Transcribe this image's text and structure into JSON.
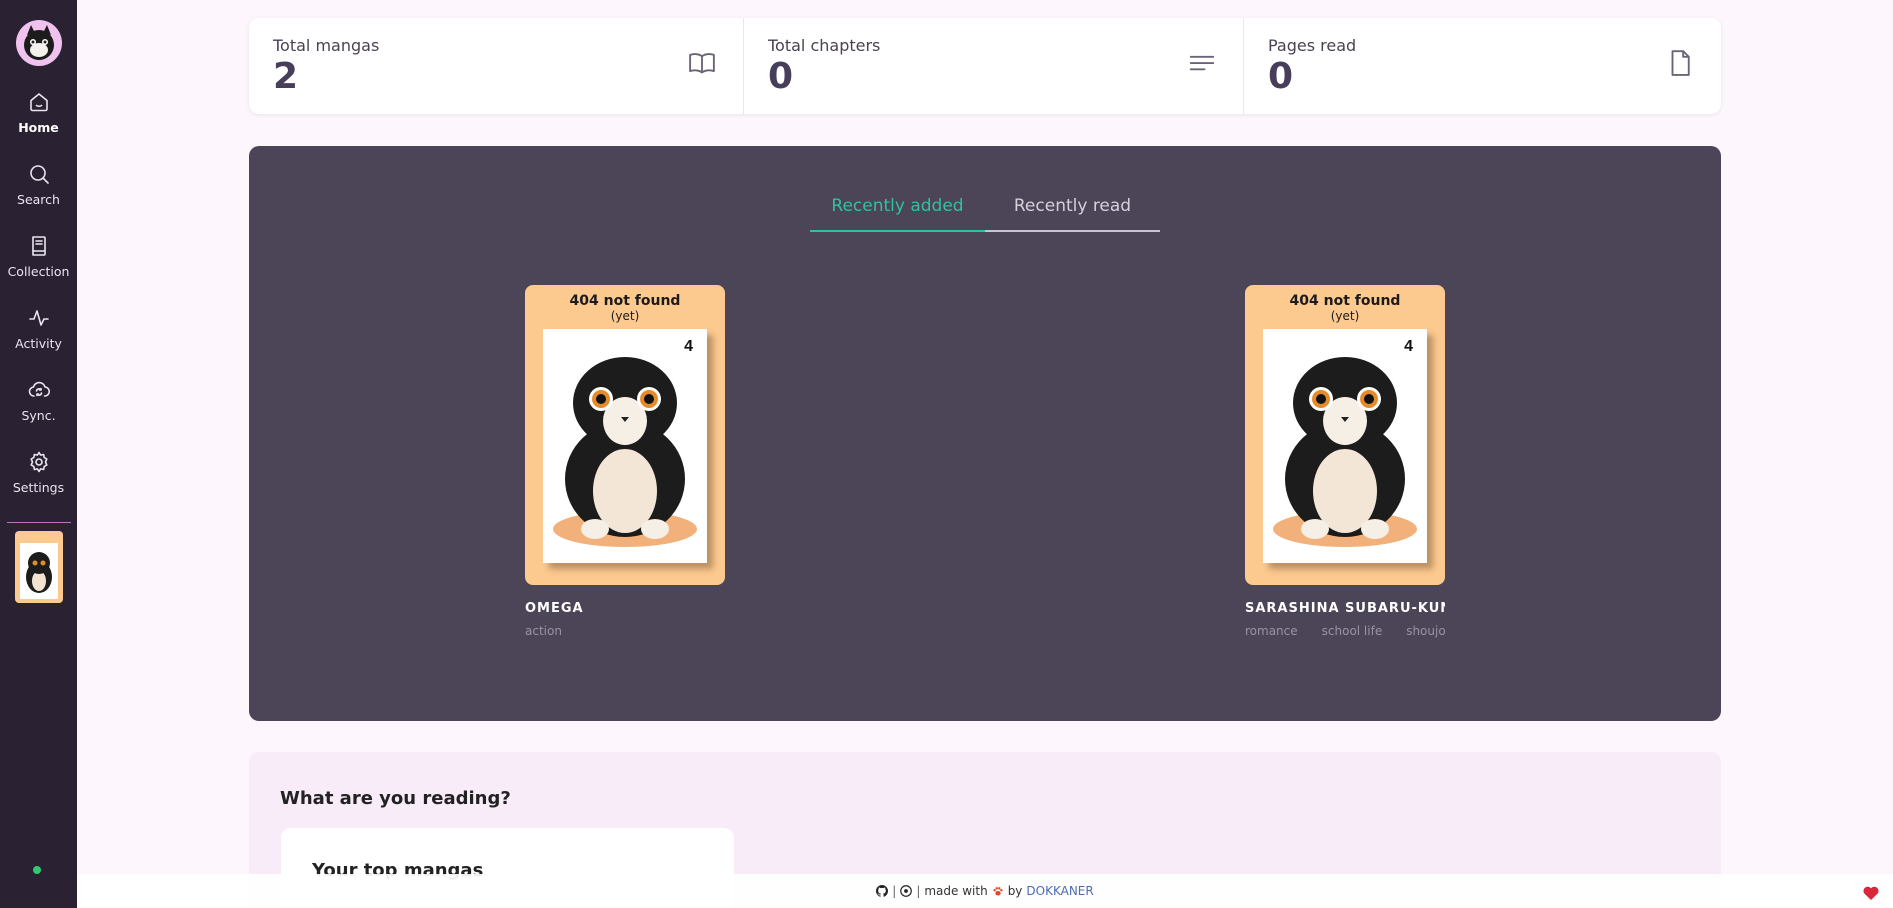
{
  "sidebar": {
    "items": [
      {
        "label": "Home",
        "icon": "home-icon",
        "active": true
      },
      {
        "label": "Search",
        "icon": "search-icon"
      },
      {
        "label": "Collection",
        "icon": "book-icon"
      },
      {
        "label": "Activity",
        "icon": "activity-icon"
      },
      {
        "label": "Sync.",
        "icon": "cloud-sync-icon"
      },
      {
        "label": "Settings",
        "icon": "gear-icon"
      }
    ],
    "status_color": "#2ecc71"
  },
  "stats": [
    {
      "label": "Total mangas",
      "value": "2",
      "icon": "book-open-icon"
    },
    {
      "label": "Total chapters",
      "value": "0",
      "icon": "lines-icon"
    },
    {
      "label": "Pages read",
      "value": "0",
      "icon": "file-icon"
    }
  ],
  "recent": {
    "tabs": [
      {
        "label": "Recently added",
        "active": true
      },
      {
        "label": "Recently read",
        "active": false
      }
    ],
    "accent": "#2cc3a1",
    "cards": [
      {
        "cover_title": "404 not found",
        "cover_subtitle": "(yet)",
        "title": "OMEGA",
        "tags": [
          "action"
        ]
      },
      {
        "cover_title": "404 not found",
        "cover_subtitle": "(yet)",
        "title": "SARASHINA SUBARU-KUN NO",
        "tags": [
          "romance",
          "school life",
          "shoujo"
        ]
      }
    ]
  },
  "reading": {
    "title": "What are you reading?",
    "top_card_title": "Your top mangas"
  },
  "footer": {
    "made_with": "made with",
    "by": "by",
    "author": "DOKKANER"
  }
}
